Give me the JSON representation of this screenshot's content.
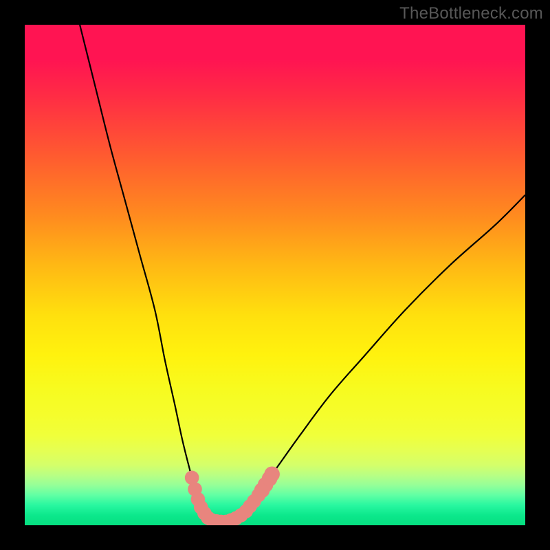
{
  "watermark": "TheBottleneck.com",
  "chart_data": {
    "type": "line",
    "title": "",
    "xlabel": "",
    "ylabel": "",
    "xlim": [
      0,
      100
    ],
    "ylim": [
      0,
      100
    ],
    "note": "V-shaped bottleneck curve on vertical red→green gradient. No axes/ticks visible. Values are estimated from pixel positions relative to 728×728 plot box, normalized 0–100.",
    "series": [
      {
        "name": "left-branch",
        "x": [
          11,
          14,
          17,
          20,
          23,
          26,
          28,
          30,
          31.5,
          33,
          34.2,
          35.2,
          36
        ],
        "y": [
          100,
          88,
          76,
          65,
          54,
          43,
          33,
          24,
          17,
          11,
          6.5,
          3.5,
          1.5
        ]
      },
      {
        "name": "valley",
        "x": [
          36,
          38,
          40,
          42,
          43.5
        ],
        "y": [
          1.5,
          0.8,
          0.6,
          0.9,
          2.2
        ]
      },
      {
        "name": "right-branch",
        "x": [
          43.5,
          46,
          50,
          55,
          61,
          68,
          76,
          85,
          94,
          100
        ],
        "y": [
          2.2,
          5.5,
          11,
          18,
          26,
          34,
          43,
          52,
          60,
          66
        ]
      }
    ],
    "markers": {
      "name": "highlighted-points",
      "color": "#e8857e",
      "note": "Pink/salmon dots clustered near valley bottom on both branches.",
      "points": [
        {
          "x": 33.4,
          "y": 9.5,
          "r": 1.2
        },
        {
          "x": 34.0,
          "y": 7.2,
          "r": 1.2
        },
        {
          "x": 34.6,
          "y": 5.2,
          "r": 1.2
        },
        {
          "x": 35.2,
          "y": 3.6,
          "r": 1.2
        },
        {
          "x": 35.9,
          "y": 2.4,
          "r": 1.2
        },
        {
          "x": 36.6,
          "y": 1.5,
          "r": 1.2
        },
        {
          "x": 37.4,
          "y": 1.0,
          "r": 1.2
        },
        {
          "x": 38.3,
          "y": 0.8,
          "r": 1.2
        },
        {
          "x": 39.2,
          "y": 0.7,
          "r": 1.2
        },
        {
          "x": 40.2,
          "y": 0.7,
          "r": 1.2
        },
        {
          "x": 41.2,
          "y": 1.0,
          "r": 1.2
        },
        {
          "x": 42.2,
          "y": 1.4,
          "r": 1.2
        },
        {
          "x": 43.2,
          "y": 2.0,
          "r": 1.2
        },
        {
          "x": 44.2,
          "y": 2.8,
          "r": 1.2
        },
        {
          "x": 45.0,
          "y": 3.8,
          "r": 1.2
        },
        {
          "x": 45.8,
          "y": 4.8,
          "r": 1.2
        },
        {
          "x": 46.7,
          "y": 6.0,
          "r": 1.2
        },
        {
          "x": 47.4,
          "y": 7.0,
          "r": 1.45
        },
        {
          "x": 48.1,
          "y": 8.1,
          "r": 1.45
        },
        {
          "x": 48.9,
          "y": 9.3,
          "r": 1.45
        },
        {
          "x": 49.4,
          "y": 10.2,
          "r": 1.45
        }
      ]
    },
    "background_gradient": [
      {
        "pos": 0,
        "color": "#ff1452"
      },
      {
        "pos": 50,
        "color": "#ffd014"
      },
      {
        "pos": 75,
        "color": "#f6ff2e"
      },
      {
        "pos": 100,
        "color": "#06df80"
      }
    ]
  }
}
